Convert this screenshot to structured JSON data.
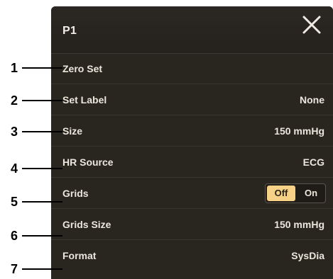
{
  "panel": {
    "title": "P1",
    "close_icon": "close-icon"
  },
  "rows": [
    {
      "label": "Zero Set",
      "value": ""
    },
    {
      "label": "Set Label",
      "value": "None"
    },
    {
      "label": "Size",
      "value": "150 mmHg"
    },
    {
      "label": "HR Source",
      "value": "ECG"
    },
    {
      "label": "Grids",
      "toggle": {
        "off": "Off",
        "on": "On",
        "selected": "Off"
      }
    },
    {
      "label": "Grids Size",
      "value": "150 mmHg"
    },
    {
      "label": "Format",
      "value": "SysDia"
    }
  ],
  "callouts": [
    "1",
    "2",
    "3",
    "4",
    "5",
    "6",
    "7"
  ],
  "colors": {
    "panel_bg": "#29251f",
    "text": "#ece7dc",
    "toggle_active": "#f6d186"
  }
}
